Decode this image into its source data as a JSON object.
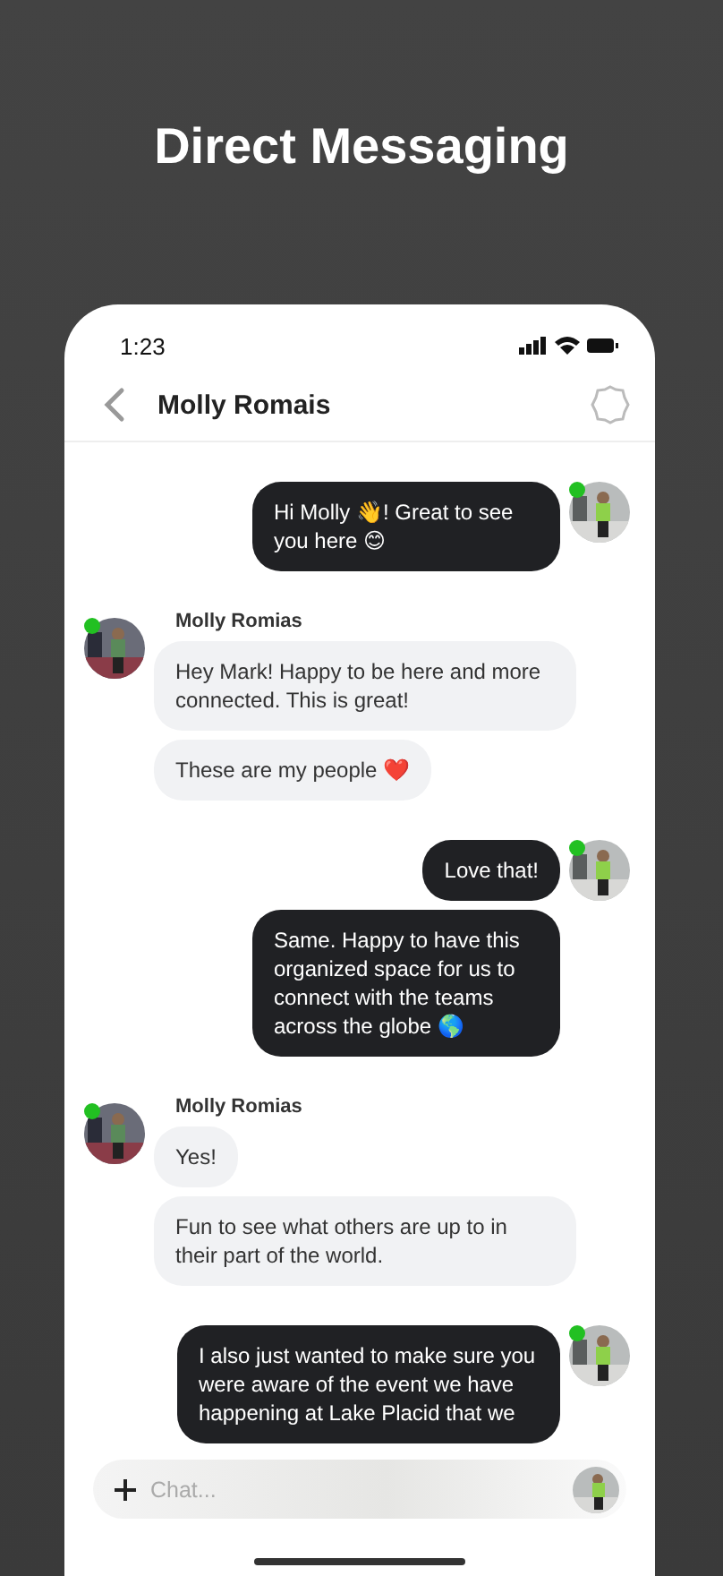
{
  "title": "Direct Messaging",
  "status_bar": {
    "time": "1:23"
  },
  "header": {
    "title": "Molly Romais"
  },
  "groups": [
    {
      "kind": "me",
      "online": true,
      "messages": [
        "Hi Molly 👋! Great to see you here 😊"
      ]
    },
    {
      "kind": "them",
      "online": true,
      "sender": "Molly Romias",
      "messages": [
        "Hey Mark! Happy to be here and more connected. This is great!",
        "These are my people ❤️"
      ]
    },
    {
      "kind": "me",
      "online": true,
      "messages": [
        "Love that!",
        "Same. Happy to have this organized space for us to connect with the teams across the globe 🌎"
      ]
    },
    {
      "kind": "them",
      "online": true,
      "sender": "Molly Romias",
      "messages": [
        "Yes!",
        "Fun to see what others are up to in their part of the world."
      ]
    },
    {
      "kind": "me",
      "online": true,
      "messages": [
        "I also just wanted to make sure you were aware of the event we have happening at Lake Placid that we"
      ]
    }
  ],
  "composer": {
    "placeholder": "Chat..."
  }
}
